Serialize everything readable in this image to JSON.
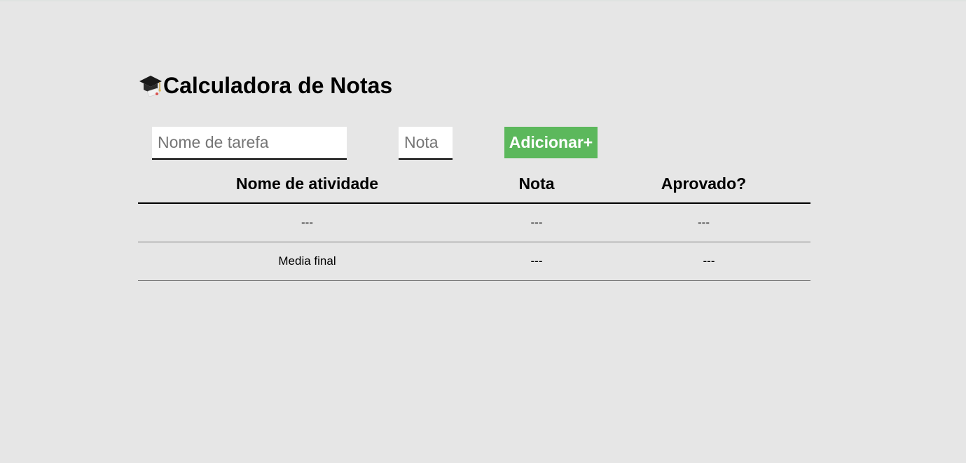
{
  "header": {
    "icon": "graduation-cap-icon",
    "title": "Calculadora de Notas"
  },
  "form": {
    "task_placeholder": "Nome de tarefa",
    "task_value": "",
    "grade_placeholder": "Nota",
    "grade_value": "",
    "add_label": "Adicionar+"
  },
  "table": {
    "headers": [
      "Nome de atividade",
      "Nota",
      "Aprovado?"
    ],
    "rows": [
      [
        "---",
        "---",
        "---"
      ]
    ],
    "final_row": [
      "Media final",
      "---",
      "---"
    ]
  },
  "colors": {
    "background": "#e6e6e6",
    "add_button": "#5cb85c"
  }
}
